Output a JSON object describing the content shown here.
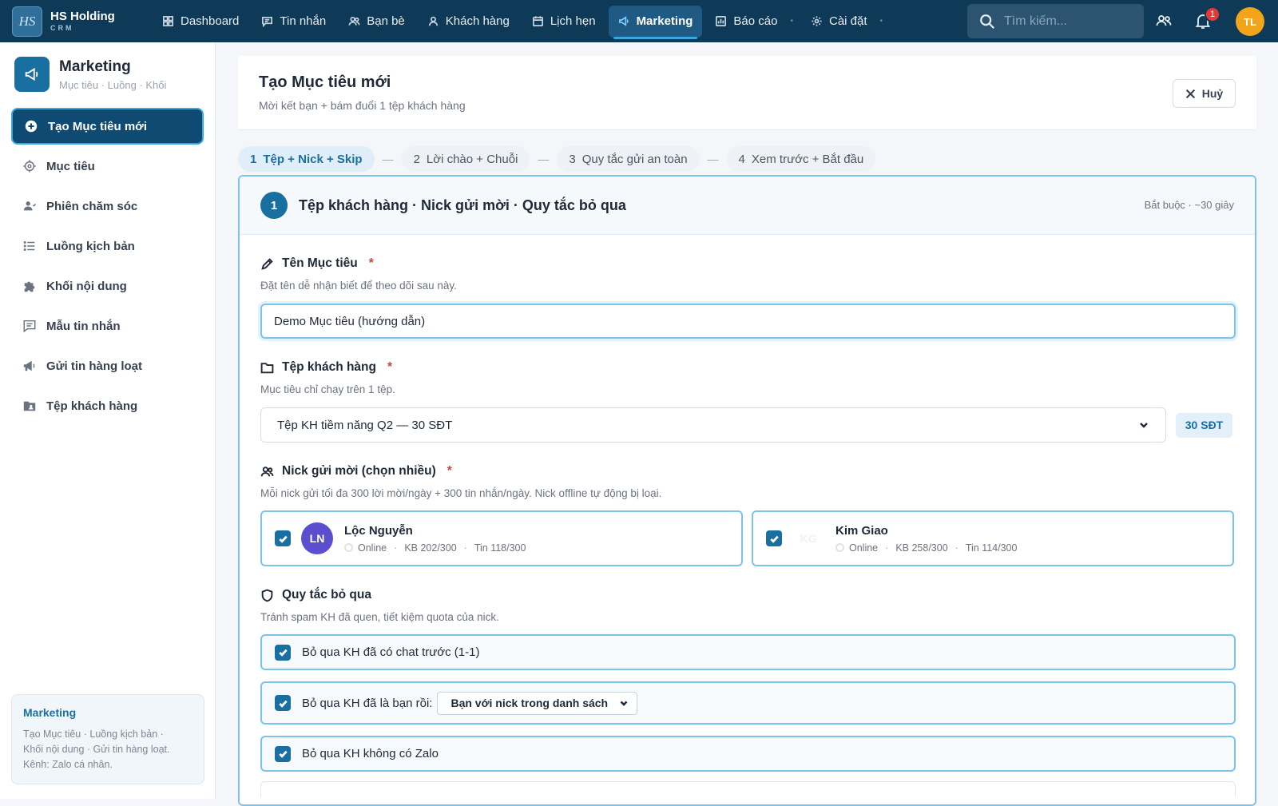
{
  "brand": {
    "logo": "HS",
    "name": "HS Holding",
    "sub": "CRM"
  },
  "nav": [
    {
      "label": "Dashboard",
      "icon": "grid-icon"
    },
    {
      "label": "Tin nhắn",
      "icon": "message-icon"
    },
    {
      "label": "Bạn bè",
      "icon": "users-icon"
    },
    {
      "label": "Khách hàng",
      "icon": "user-icon"
    },
    {
      "label": "Lịch hẹn",
      "icon": "calendar-icon"
    },
    {
      "label": "Marketing",
      "icon": "megaphone-icon",
      "active": true
    },
    {
      "label": "Báo cáo",
      "icon": "chart-icon"
    },
    {
      "label": "Cài đặt",
      "icon": "gear-icon"
    }
  ],
  "search": {
    "placeholder": "Tìm kiếm..."
  },
  "notifications": {
    "count": "1"
  },
  "user": {
    "initials": "TL",
    "color": "#f2a51a"
  },
  "sidebar": {
    "title": "Marketing",
    "subtitle": "Mục tiêu · Luồng · Khối",
    "items": [
      {
        "label": "Tạo Mục tiêu mới",
        "icon": "plus-circle-icon",
        "active": true
      },
      {
        "label": "Mục tiêu",
        "icon": "target-icon"
      },
      {
        "label": "Phiên chăm sóc",
        "icon": "user-care-icon"
      },
      {
        "label": "Luồng kịch bản",
        "icon": "list-icon"
      },
      {
        "label": "Khối nội dung",
        "icon": "puzzle-icon"
      },
      {
        "label": "Mẫu tin nhắn",
        "icon": "message-template-icon"
      },
      {
        "label": "Gửi tin hàng loạt",
        "icon": "broadcast-icon"
      },
      {
        "label": "Tệp khách hàng",
        "icon": "contacts-folder-icon"
      }
    ],
    "info": {
      "title": "Marketing",
      "line1": "Tạo Mục tiêu · Luồng kịch bản ·",
      "line2": "Khối nội dung · Gửi tin hàng loạt.",
      "line3": "Kênh: Zalo cá nhân."
    }
  },
  "page": {
    "title": "Tạo Mục tiêu mới",
    "subtitle": "Mời kết bạn + bám đuổi 1 tệp khách hàng",
    "cancel_label": "Huỷ"
  },
  "steps": [
    {
      "num": "1",
      "label": "Tệp + Nick + Skip",
      "active": true
    },
    {
      "num": "2",
      "label": "Lời chào + Chuỗi"
    },
    {
      "num": "3",
      "label": "Quy tắc gửi an toàn"
    },
    {
      "num": "4",
      "label": "Xem trước + Bắt đầu"
    }
  ],
  "step_sep": "—",
  "form": {
    "step_num": "1",
    "title": "Tệp khách hàng · Nick gửi mời · Quy tắc bỏ qua",
    "meta": "Bắt buộc · ~30 giây",
    "name_field": {
      "label": "Tên Mục tiêu",
      "required": "*",
      "hint": "Đặt tên dễ nhận biết để theo dõi sau này.",
      "value": "Demo Mục tiêu (hướng dẫn)"
    },
    "list_field": {
      "label": "Tệp khách hàng",
      "required": "*",
      "hint": "Mục tiêu chỉ chạy trên 1 tệp.",
      "selected": "Tệp KH tiềm năng Q2 — 30 SĐT",
      "badge": "30 SĐT"
    },
    "nick_field": {
      "label": "Nick gửi mời (chọn nhiều)",
      "required": "*",
      "hint": "Mỗi nick gửi tối đa 300 lời mời/ngày + 300 tin nhắn/ngày. Nick offline tự động bị loại.",
      "nicks": [
        {
          "initials": "LN",
          "name": "Lộc Nguyễn",
          "status": "Online",
          "kb": "KB 202/300",
          "tin": "Tin 118/300",
          "checked": true,
          "avatar_color": "#6a5acd"
        },
        {
          "initials": "KG",
          "name": "Kim Giao",
          "status": "Online",
          "kb": "KB 258/300",
          "tin": "Tin 114/300",
          "checked": true,
          "avatar_color": "#ffffff"
        }
      ],
      "meta_sep": "·"
    },
    "skip_field": {
      "label": "Quy tắc bỏ qua",
      "hint": "Tránh spam KH đã quen, tiết kiệm quota của nick.",
      "rules": [
        {
          "label": "Bỏ qua KH đã có chat trước (1-1)",
          "checked": true
        },
        {
          "label": "Bỏ qua KH đã là bạn rồi:",
          "checked": true,
          "select": "Bạn với nick trong danh sách"
        },
        {
          "label": "Bỏ qua KH không có Zalo",
          "checked": true
        }
      ]
    }
  }
}
